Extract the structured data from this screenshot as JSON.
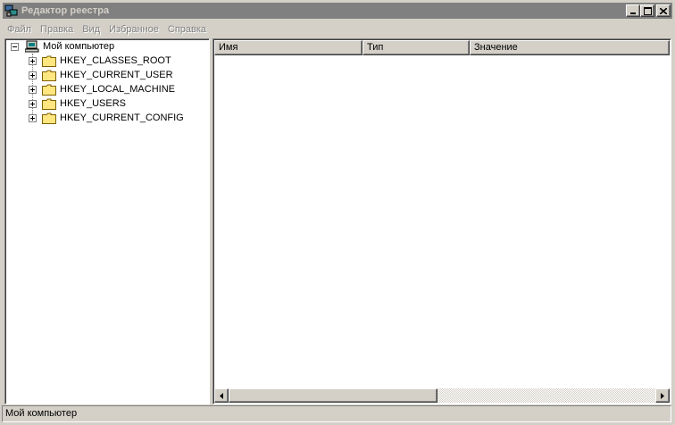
{
  "window": {
    "title": "Редактор реестра",
    "icon": "registry-icon",
    "controls": [
      "minimize-icon",
      "maximize-icon",
      "close-icon"
    ]
  },
  "menu": {
    "items": [
      "Файл",
      "Правка",
      "Вид",
      "Избранное",
      "Справка"
    ]
  },
  "tree": {
    "root": {
      "label": "Мой компьютер",
      "icon": "computer-icon",
      "expanded": true
    },
    "children": [
      {
        "label": "HKEY_CLASSES_ROOT",
        "icon": "folder-icon"
      },
      {
        "label": "HKEY_CURRENT_USER",
        "icon": "folder-icon"
      },
      {
        "label": "HKEY_LOCAL_MACHINE",
        "icon": "folder-icon"
      },
      {
        "label": "HKEY_USERS",
        "icon": "folder-icon"
      },
      {
        "label": "HKEY_CURRENT_CONFIG",
        "icon": "folder-icon"
      }
    ]
  },
  "list": {
    "columns": [
      "Имя",
      "Тип",
      "Значение"
    ],
    "rows": []
  },
  "status": {
    "text": "Мой компьютер"
  },
  "colors": {
    "title_inactive": "#808080",
    "face": "#d4d0c8",
    "folder": "#ffe680"
  }
}
